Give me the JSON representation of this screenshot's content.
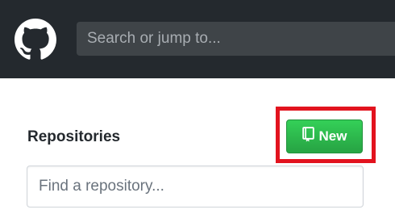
{
  "header": {
    "logo_icon": "github-mark-icon",
    "search": {
      "value": "",
      "placeholder": "Search or jump to..."
    }
  },
  "sidebar": {
    "title": "Repositories",
    "new_button": {
      "label": "New",
      "icon": "repo-book-icon"
    },
    "filter": {
      "value": "",
      "placeholder": "Find a repository..."
    }
  },
  "annotation": {
    "highlight_color": "#e2131e"
  },
  "colors": {
    "header_bg": "#24292e",
    "button_green": "#28a745"
  }
}
